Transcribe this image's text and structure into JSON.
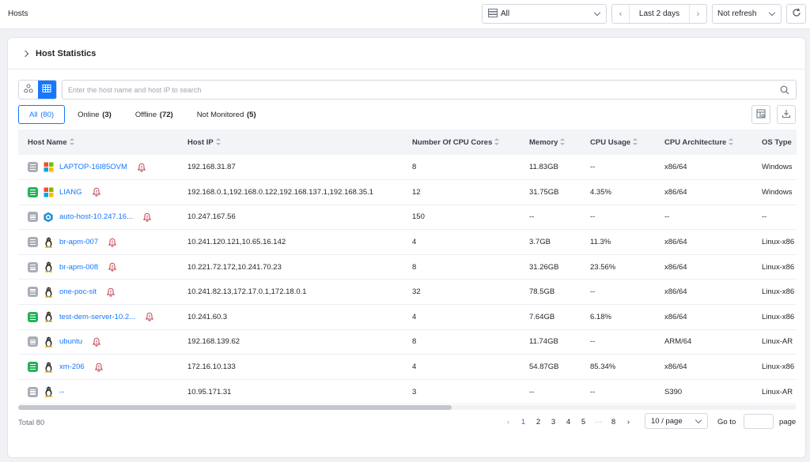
{
  "page": {
    "title": "Hosts"
  },
  "toolbar": {
    "environment": "All",
    "time_range": "Last 2 days",
    "refresh": "Not refresh"
  },
  "stats": {
    "title": "Host Statistics"
  },
  "search": {
    "placeholder": "Enter the host name and host IP to search"
  },
  "filters": [
    {
      "label": "All",
      "count": "(80)"
    },
    {
      "label": "Online",
      "count": "(3)"
    },
    {
      "label": "Offline",
      "count": "(72)"
    },
    {
      "label": "Not Monitored",
      "count": "(5)"
    }
  ],
  "table": {
    "columns": [
      "Host Name",
      "Host IP",
      "Number Of CPU Cores",
      "Memory",
      "CPU Usage",
      "CPU Architecture",
      "OS Type"
    ],
    "rows": [
      {
        "status": "offline",
        "os": "windows-icon",
        "name": "LAPTOP-16I85OVM",
        "ip": "192.168.31.87",
        "cores": "8",
        "memory": "11.83GB",
        "cpu": "--",
        "arch": "x86/64",
        "ostype": "Windows"
      },
      {
        "status": "online",
        "os": "windows-icon",
        "name": "LIANG",
        "ip": "192.168.0.1,192.168.0.122,192.168.137.1,192.168.35.1",
        "cores": "12",
        "memory": "31.75GB",
        "cpu": "4.35%",
        "arch": "x86/64",
        "ostype": "Windows"
      },
      {
        "status": "offline",
        "os": "hexagon-icon",
        "name": "auto-host-10.247.16...",
        "ip": "10.247.167.56",
        "cores": "150",
        "memory": "--",
        "cpu": "--",
        "arch": "--",
        "ostype": "--"
      },
      {
        "status": "offline",
        "os": "linux-icon",
        "name": "br-apm-007",
        "ip": "10.241.120.121,10.65.16.142",
        "cores": "4",
        "memory": "3.7GB",
        "cpu": "11.3%",
        "arch": "x86/64",
        "ostype": "Linux-x86"
      },
      {
        "status": "offline",
        "os": "linux-icon",
        "name": "br-apm-008",
        "ip": "10.221.72.172,10.241.70.23",
        "cores": "8",
        "memory": "31.26GB",
        "cpu": "23.56%",
        "arch": "x86/64",
        "ostype": "Linux-x86"
      },
      {
        "status": "offline",
        "os": "linux-icon",
        "name": "one-poc-sit",
        "ip": "10.241.82.13,172.17.0.1,172.18.0.1",
        "cores": "32",
        "memory": "78.5GB",
        "cpu": "--",
        "arch": "x86/64",
        "ostype": "Linux-x86"
      },
      {
        "status": "online",
        "os": "linux-icon",
        "name": "test-dem-server-10.2...",
        "ip": "10.241.60.3",
        "cores": "4",
        "memory": "7.64GB",
        "cpu": "6.18%",
        "arch": "x86/64",
        "ostype": "Linux-x86"
      },
      {
        "status": "offline",
        "os": "linux-icon",
        "name": "ubuntu",
        "ip": "192.168.139.62",
        "cores": "8",
        "memory": "11.74GB",
        "cpu": "--",
        "arch": "ARM/64",
        "ostype": "Linux-AR"
      },
      {
        "status": "online",
        "os": "linux-icon",
        "name": "xm-206",
        "ip": "172.16.10.133",
        "cores": "4",
        "memory": "54.87GB",
        "cpu": "85.34%",
        "arch": "x86/64",
        "ostype": "Linux-x86"
      },
      {
        "status": "offline",
        "os": "linux-icon",
        "name": "--",
        "ip": "10.95.171.31",
        "cores": "3",
        "memory": "--",
        "cpu": "--",
        "arch": "S390",
        "ostype": "Linux-AR"
      }
    ]
  },
  "pagination": {
    "total": "Total 80",
    "pages": [
      "1",
      "2",
      "3",
      "4",
      "5",
      "···",
      "8"
    ],
    "current": "1",
    "page_size": "10 / page",
    "goto_label": "Go to",
    "goto_suffix": "page"
  },
  "colors": {
    "accent": "#1677ff",
    "online": "#22b357",
    "offline": "#a9adb5",
    "alarm": "#c0394b"
  }
}
